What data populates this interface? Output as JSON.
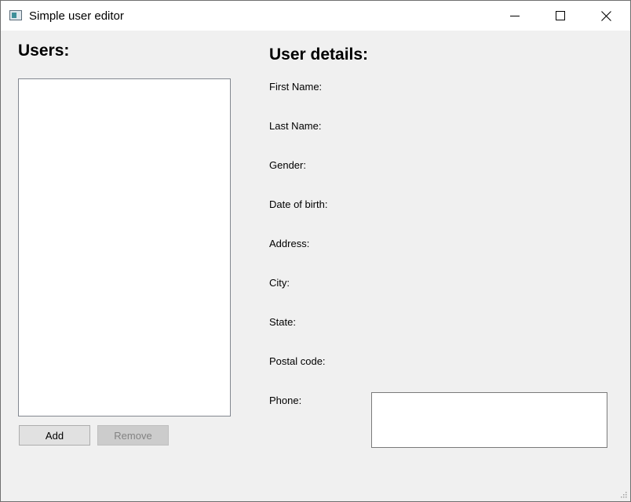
{
  "window": {
    "title": "Simple user editor"
  },
  "titlebar_buttons": {
    "minimize_icon": "minimize-icon",
    "maximize_icon": "maximize-icon",
    "close_icon": "close-icon"
  },
  "users_panel": {
    "heading": "Users:",
    "add_label": "Add",
    "remove_label": "Remove",
    "items": []
  },
  "details_panel": {
    "heading": "User details:",
    "fields": [
      {
        "label": "First Name:"
      },
      {
        "label": "Last Name:"
      },
      {
        "label": "Gender:"
      },
      {
        "label": "Date of birth:"
      },
      {
        "label": "Address:"
      },
      {
        "label": "City:"
      },
      {
        "label": "State:"
      },
      {
        "label": "Postal code:"
      },
      {
        "label": "Phone:"
      }
    ]
  }
}
